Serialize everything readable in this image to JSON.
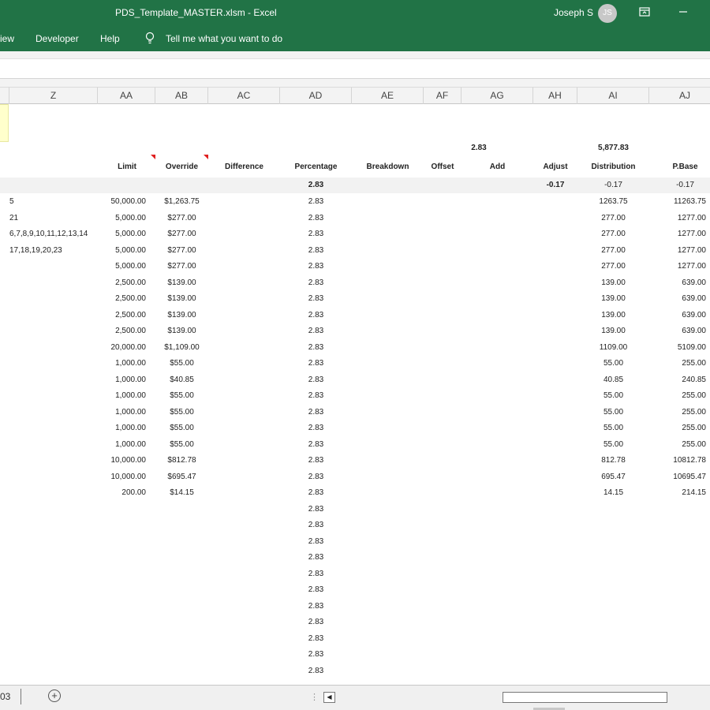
{
  "window": {
    "title": "PDS_Template_MASTER.xlsm  -  Excel",
    "user_name": "Joseph S",
    "user_initials": "JS"
  },
  "ribbon": {
    "tabs": [
      "iew",
      "Developer",
      "Help"
    ],
    "tell_me": "Tell me what you want to do"
  },
  "columns": [
    "Z",
    "AA",
    "AB",
    "AC",
    "AD",
    "AE",
    "AF",
    "AG",
    "AH",
    "AI",
    "AJ"
  ],
  "summary_row": {
    "ag": "2.83",
    "ai": "5,877.83"
  },
  "headers": {
    "aa": "Limit",
    "ab": "Override",
    "ac": "Difference",
    "ad": "Percentage",
    "ae": "Breakdown",
    "af": "Offset",
    "ag": "Add",
    "ah": "Adjust",
    "ai": "Distribution",
    "aj": "P.Base"
  },
  "band_row": {
    "ad": "2.83",
    "ah": "-0.17",
    "ai": "-0.17",
    "aj": "-0.17"
  },
  "rows": [
    {
      "z": "5",
      "aa": "50,000.00",
      "ab": "$1,263.75",
      "ad": "2.83",
      "ai": "1263.75",
      "aj": "11263.75"
    },
    {
      "z": "21",
      "aa": "5,000.00",
      "ab": "$277.00",
      "ad": "2.83",
      "ai": "277.00",
      "aj": "1277.00"
    },
    {
      "z": "6,7,8,9,10,11,12,13,14",
      "aa": "5,000.00",
      "ab": "$277.00",
      "ad": "2.83",
      "ai": "277.00",
      "aj": "1277.00"
    },
    {
      "z": "17,18,19,20,23",
      "aa": "5,000.00",
      "ab": "$277.00",
      "ad": "2.83",
      "ai": "277.00",
      "aj": "1277.00"
    },
    {
      "z": "",
      "aa": "5,000.00",
      "ab": "$277.00",
      "ad": "2.83",
      "ai": "277.00",
      "aj": "1277.00"
    },
    {
      "z": "",
      "aa": "2,500.00",
      "ab": "$139.00",
      "ad": "2.83",
      "ai": "139.00",
      "aj": "639.00"
    },
    {
      "z": "",
      "aa": "2,500.00",
      "ab": "$139.00",
      "ad": "2.83",
      "ai": "139.00",
      "aj": "639.00"
    },
    {
      "z": "",
      "aa": "2,500.00",
      "ab": "$139.00",
      "ad": "2.83",
      "ai": "139.00",
      "aj": "639.00"
    },
    {
      "z": "",
      "aa": "2,500.00",
      "ab": "$139.00",
      "ad": "2.83",
      "ai": "139.00",
      "aj": "639.00"
    },
    {
      "z": "",
      "aa": "20,000.00",
      "ab": "$1,109.00",
      "ad": "2.83",
      "ai": "1109.00",
      "aj": "5109.00"
    },
    {
      "z": "",
      "aa": "1,000.00",
      "ab": "$55.00",
      "ad": "2.83",
      "ai": "55.00",
      "aj": "255.00"
    },
    {
      "z": "",
      "aa": "1,000.00",
      "ab": "$40.85",
      "ad": "2.83",
      "ai": "40.85",
      "aj": "240.85"
    },
    {
      "z": "",
      "aa": "1,000.00",
      "ab": "$55.00",
      "ad": "2.83",
      "ai": "55.00",
      "aj": "255.00"
    },
    {
      "z": "",
      "aa": "1,000.00",
      "ab": "$55.00",
      "ad": "2.83",
      "ai": "55.00",
      "aj": "255.00"
    },
    {
      "z": "",
      "aa": "1,000.00",
      "ab": "$55.00",
      "ad": "2.83",
      "ai": "55.00",
      "aj": "255.00"
    },
    {
      "z": "",
      "aa": "1,000.00",
      "ab": "$55.00",
      "ad": "2.83",
      "ai": "55.00",
      "aj": "255.00"
    },
    {
      "z": "",
      "aa": "10,000.00",
      "ab": "$812.78",
      "ad": "2.83",
      "ai": "812.78",
      "aj": "10812.78"
    },
    {
      "z": "",
      "aa": "10,000.00",
      "ab": "$695.47",
      "ad": "2.83",
      "ai": "695.47",
      "aj": "10695.47"
    },
    {
      "z": "",
      "aa": "200.00",
      "ab": "$14.15",
      "ad": "2.83",
      "ai": "14.15",
      "aj": "214.15"
    },
    {
      "z": "",
      "aa": "",
      "ab": "",
      "ad": "2.83",
      "ai": "",
      "aj": ""
    },
    {
      "z": "",
      "aa": "",
      "ab": "",
      "ad": "2.83",
      "ai": "",
      "aj": ""
    },
    {
      "z": "",
      "aa": "",
      "ab": "",
      "ad": "2.83",
      "ai": "",
      "aj": ""
    },
    {
      "z": "",
      "aa": "",
      "ab": "",
      "ad": "2.83",
      "ai": "",
      "aj": ""
    },
    {
      "z": "",
      "aa": "",
      "ab": "",
      "ad": "2.83",
      "ai": "",
      "aj": ""
    },
    {
      "z": "",
      "aa": "",
      "ab": "",
      "ad": "2.83",
      "ai": "",
      "aj": ""
    },
    {
      "z": "",
      "aa": "",
      "ab": "",
      "ad": "2.83",
      "ai": "",
      "aj": ""
    },
    {
      "z": "",
      "aa": "",
      "ab": "",
      "ad": "2.83",
      "ai": "",
      "aj": ""
    },
    {
      "z": "",
      "aa": "",
      "ab": "",
      "ad": "2.83",
      "ai": "",
      "aj": ""
    },
    {
      "z": "",
      "aa": "",
      "ab": "",
      "ad": "2.83",
      "ai": "",
      "aj": ""
    },
    {
      "z": "",
      "aa": "",
      "ab": "",
      "ad": "2.83",
      "ai": "",
      "aj": ""
    }
  ],
  "sheet_tab": "03",
  "colors": {
    "excel_green": "#217346",
    "comment_red": "#e02020",
    "highlight_yellow": "#ffffcc"
  },
  "icons": [
    "lightbulb-icon",
    "ribbon-display-icon",
    "minimize-icon",
    "add-sheet-icon",
    "scroll-left-icon"
  ]
}
